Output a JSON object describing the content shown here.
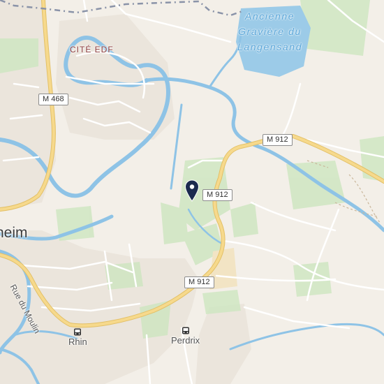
{
  "map": {
    "labels": {
      "cite_edf": "CITÉ EDF",
      "town_partial": "heim",
      "street": "Rue du Moulin"
    },
    "water": {
      "lake_name": "Ancienne\nGravière du\nLangensand"
    },
    "road_shields": {
      "m468": "M 468",
      "m912_north": "M 912",
      "m912_center": "M 912",
      "m912_south": "M 912"
    },
    "bus_stops": {
      "rhin": "Rhin",
      "perdrix": "Perdrix"
    },
    "marker": {
      "icon": "map-pin-icon",
      "color": "#1b2a4e"
    },
    "colors": {
      "land": "#f3efe8",
      "green": "#cfe6c2",
      "water": "#9ccbe8",
      "river": "#8ec3e6",
      "road_major": "#f6d98c",
      "road_minor": "#ffffff",
      "urban": "#ebe5dc"
    }
  }
}
